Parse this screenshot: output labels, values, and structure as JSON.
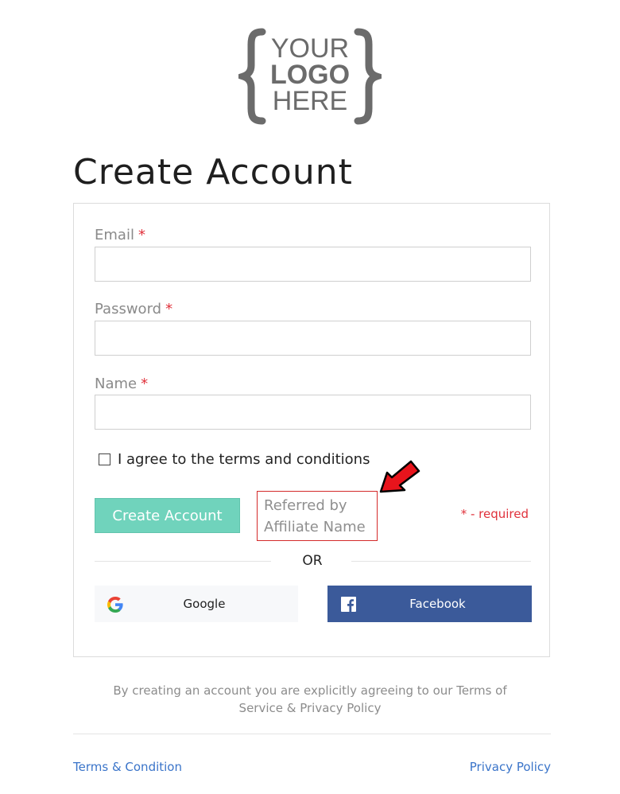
{
  "logo": {
    "line1": "YOUR",
    "line2": "LOGO",
    "line3": "HERE"
  },
  "page_title": "Create Account",
  "form": {
    "email": {
      "label": "Email",
      "required_mark": "*",
      "value": "",
      "placeholder": ""
    },
    "password": {
      "label": "Password",
      "required_mark": "*",
      "value": "",
      "placeholder": ""
    },
    "name": {
      "label": "Name",
      "required_mark": "*",
      "value": "",
      "placeholder": ""
    },
    "agree": {
      "label": "I agree to the terms and conditions",
      "checked": false
    },
    "submit_label": "Create Account",
    "referred": {
      "line1": "Referred by",
      "line2": "Affiliate Name"
    },
    "required_note": "* - required",
    "or_text": "OR",
    "google_label": "Google",
    "facebook_label": "Facebook"
  },
  "disclaimer": {
    "line1": "By creating an account you are explicitly agreeing to our Terms of",
    "line2": "Service & Privacy Policy"
  },
  "footer": {
    "terms_link": "Terms & Condition",
    "privacy_link": "Privacy Policy"
  },
  "colors": {
    "accent_button": "#70d3bc",
    "facebook": "#3b5a9a",
    "required": "#e0313b",
    "link": "#3a74c9",
    "highlight_box": "#d42a2a"
  },
  "icons": [
    "google-icon",
    "facebook-icon",
    "checkbox",
    "red-arrow"
  ]
}
